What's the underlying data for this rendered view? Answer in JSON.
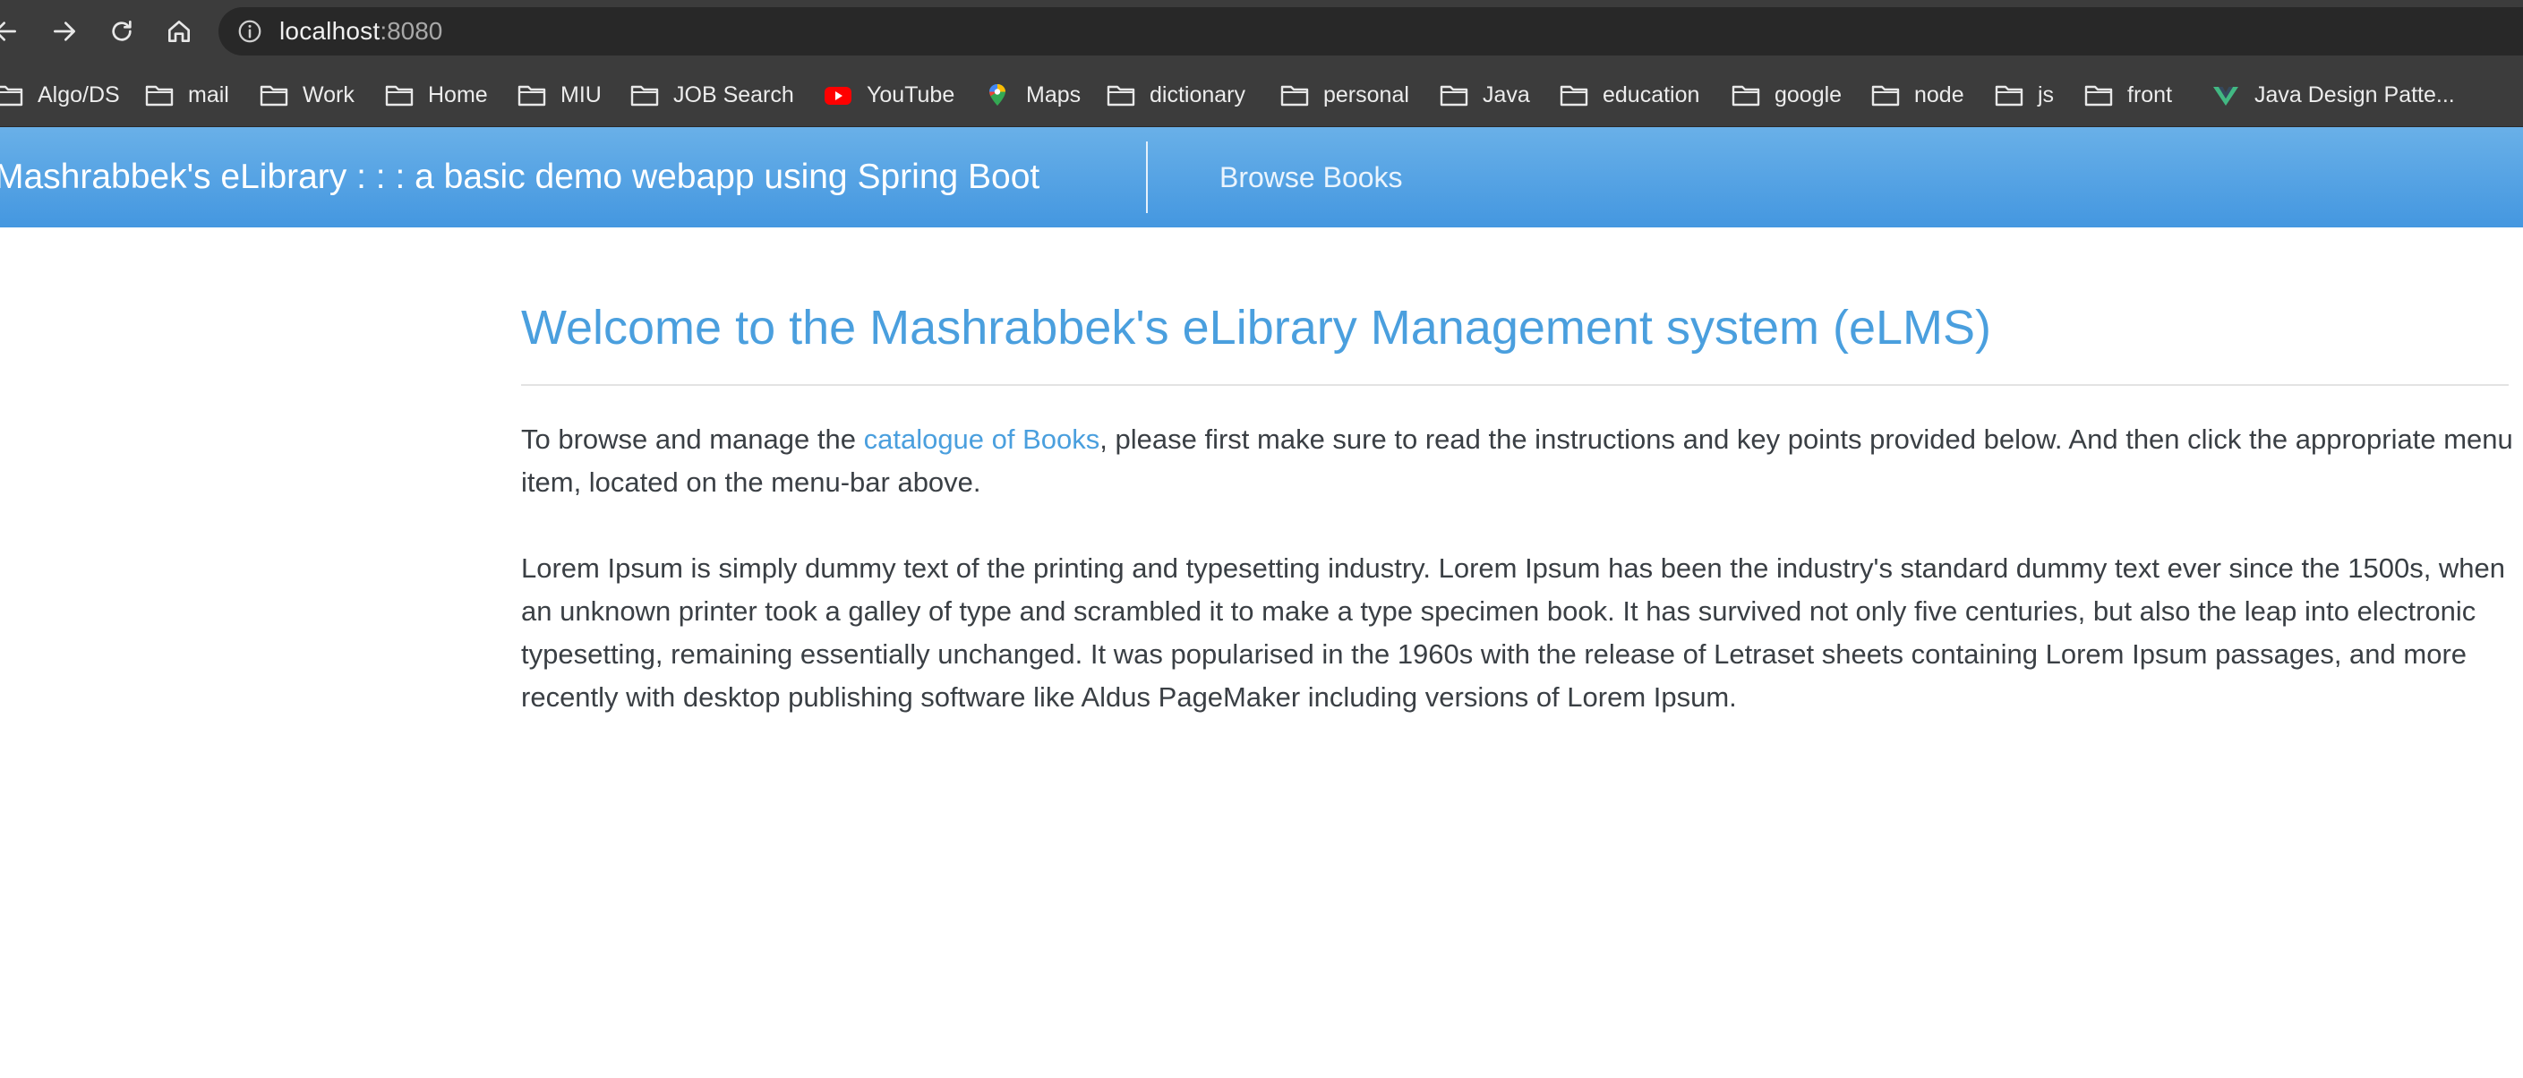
{
  "browser": {
    "url_host": "localhost",
    "url_port": ":8080",
    "bookmarks": [
      {
        "label": "Algo/DS",
        "icon": "folder-icon"
      },
      {
        "label": "mail",
        "icon": "folder-icon"
      },
      {
        "label": "Work",
        "icon": "folder-icon"
      },
      {
        "label": "Home",
        "icon": "folder-icon"
      },
      {
        "label": "MIU",
        "icon": "folder-icon"
      },
      {
        "label": "JOB Search",
        "icon": "folder-icon"
      },
      {
        "label": "YouTube",
        "icon": "youtube-icon"
      },
      {
        "label": "Maps",
        "icon": "maps-pin-icon"
      },
      {
        "label": "dictionary",
        "icon": "folder-icon"
      },
      {
        "label": "personal",
        "icon": "folder-icon"
      },
      {
        "label": "Java",
        "icon": "folder-icon"
      },
      {
        "label": "education",
        "icon": "folder-icon"
      },
      {
        "label": "google",
        "icon": "folder-icon"
      },
      {
        "label": "node",
        "icon": "folder-icon"
      },
      {
        "label": "js",
        "icon": "folder-icon"
      },
      {
        "label": "front",
        "icon": "folder-icon"
      },
      {
        "label": "Java Design Patte...",
        "icon": "vue-logo-icon"
      }
    ]
  },
  "app": {
    "brand": "Mashrabbek's eLibrary : : : a basic demo webapp using Spring Boot",
    "nav_browse": "Browse Books"
  },
  "main": {
    "title": "Welcome to the Mashrabbek's eLibrary Management system (eLMS)",
    "intro_before_link": "To browse and manage the ",
    "intro_link": "catalogue of Books",
    "intro_after_link": ", please first make sure to read the instructions and key points provided below. And then click the appropriate menu item, located on the menu-bar above.",
    "lorem": "Lorem Ipsum is simply dummy text of the printing and typesetting industry. Lorem Ipsum has been the industry's standard dummy text ever since the 1500s, when an unknown printer took a galley of type and scrambled it to make a type specimen book. It has survived not only five centuries, but also the leap into electronic typesetting, remaining essentially unchanged. It was popularised in the 1960s with the release of Letraset sheets containing Lorem Ipsum passages, and more recently with desktop publishing software like Aldus PageMaker including versions of Lorem Ipsum."
  },
  "colors": {
    "navbar_top": "#69b0e8",
    "navbar_bottom": "#4497e0",
    "accent": "#4a9fde",
    "text": "#3a3f44",
    "chrome": "#3c3c3c"
  }
}
